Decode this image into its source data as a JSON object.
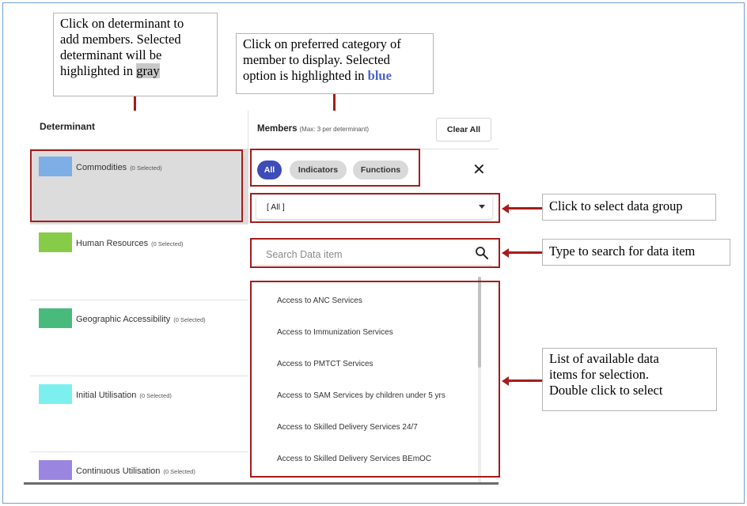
{
  "callouts": {
    "determinant_hint": [
      "Click on determinant to",
      "add members. Selected",
      "determinant will be",
      "highlighted in "
    ],
    "determinant_hint_gray": "gray",
    "category_hint": [
      "Click on preferred category of",
      "member to display. Selected",
      "option is highlighted in "
    ],
    "category_hint_blue": "blue",
    "data_group_hint": "Click to select data group",
    "search_hint": "Type to search for data item",
    "list_hint": [
      "List of available data",
      "items for selection.",
      "Double click to select"
    ]
  },
  "colors": {
    "annotation_red": "#a51c1c",
    "highlight_blue": "#3d4db8",
    "highlight_gray": "#dcdcdc"
  },
  "determinant": {
    "header": "Determinant",
    "items": [
      {
        "label": "Commodities",
        "selected": "(0 Selected)",
        "color": "#7eaee6",
        "active": true
      },
      {
        "label": "Human Resources",
        "selected": "(0 Selected)",
        "color": "#86cc48",
        "active": false
      },
      {
        "label": "Geographic Accessibility",
        "selected": "(0 Selected)",
        "color": "#48bb7c",
        "active": false
      },
      {
        "label": "Initial Utilisation",
        "selected": "(0 Selected)",
        "color": "#7cf0ee",
        "active": false
      },
      {
        "label": "Continuous Utilisation",
        "selected": "(0 Selected)",
        "color": "#9a86e0",
        "active": false
      }
    ]
  },
  "members": {
    "title": "Members",
    "subtitle": "(Max: 3 per determinant)",
    "clear_all": "Clear All",
    "chips": [
      {
        "label": "All",
        "selected": true
      },
      {
        "label": "Indicators",
        "selected": false
      },
      {
        "label": "Functions",
        "selected": false
      }
    ],
    "close_icon": "close-icon",
    "data_group_value": "[ All ]",
    "search_placeholder": "Search Data item",
    "items": [
      "Access to ANC Services",
      "Access to Immunization Services",
      "Access to PMTCT Services",
      "Access to SAM Services by children under 5 yrs",
      "Access to Skilled Delivery Services 24/7",
      "Access to Skilled Delivery Services BEmOC"
    ]
  }
}
